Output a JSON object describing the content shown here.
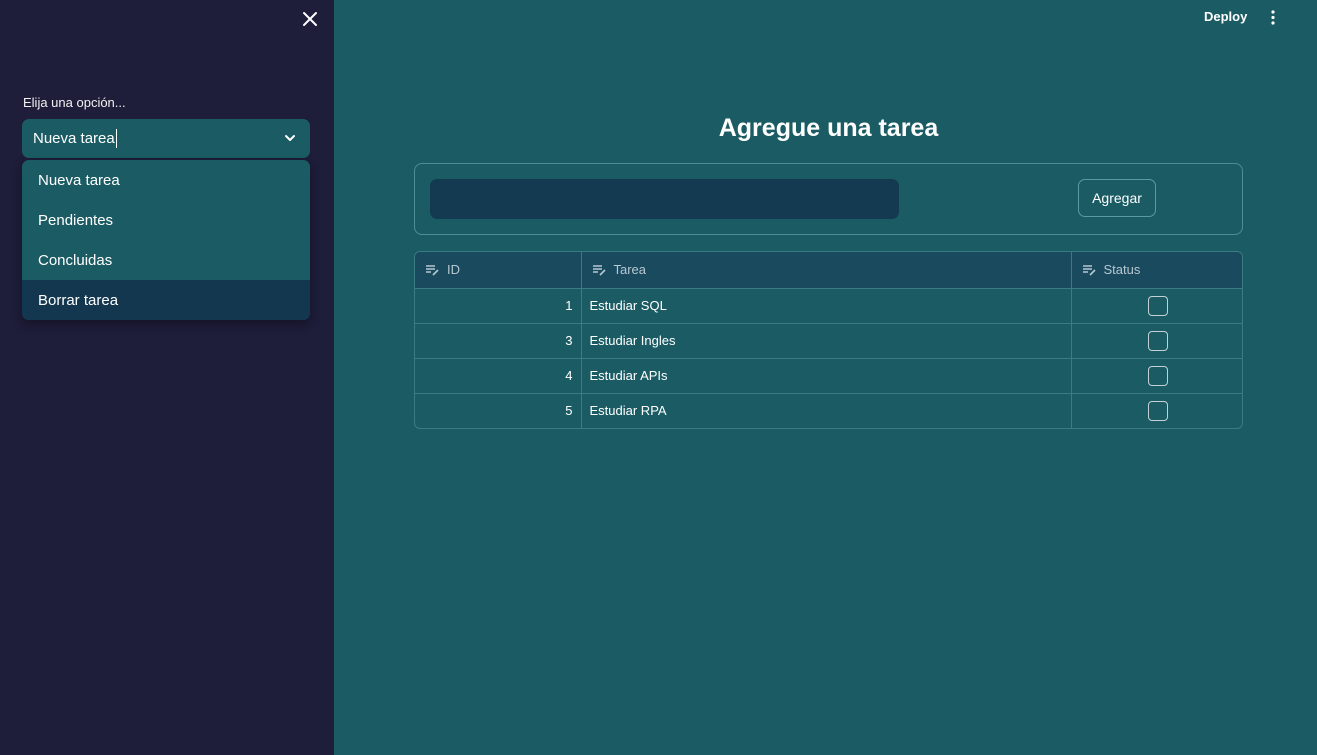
{
  "sidebar": {
    "select_label": "Elija una opción...",
    "select_value": "Nueva tarea",
    "options": [
      {
        "label": "Nueva tarea"
      },
      {
        "label": "Pendientes"
      },
      {
        "label": "Concluidas"
      },
      {
        "label": "Borrar tarea"
      }
    ],
    "highlighted_option": "Borrar tarea"
  },
  "header": {
    "deploy_label": "Deploy"
  },
  "main": {
    "title": "Agregue una tarea",
    "input_value": "",
    "add_button_label": "Agregar",
    "table": {
      "columns": [
        "ID",
        "Tarea",
        "Status"
      ],
      "rows": [
        {
          "id": "1",
          "tarea": "Estudiar SQL",
          "status": false
        },
        {
          "id": "3",
          "tarea": "Estudiar Ingles",
          "status": false
        },
        {
          "id": "4",
          "tarea": "Estudiar APIs",
          "status": false
        },
        {
          "id": "5",
          "tarea": "Estudiar RPA",
          "status": false
        }
      ]
    }
  },
  "colors": {
    "main_background": "#1b5c64",
    "sidebar_background": "#1e1d3a",
    "input_background": "#143a52",
    "highlight_option": "#12374f"
  },
  "icons": {
    "close": "close-icon",
    "chevron": "chevron-down-icon",
    "menu": "more-vertical-icon",
    "column": "text-column-icon"
  }
}
